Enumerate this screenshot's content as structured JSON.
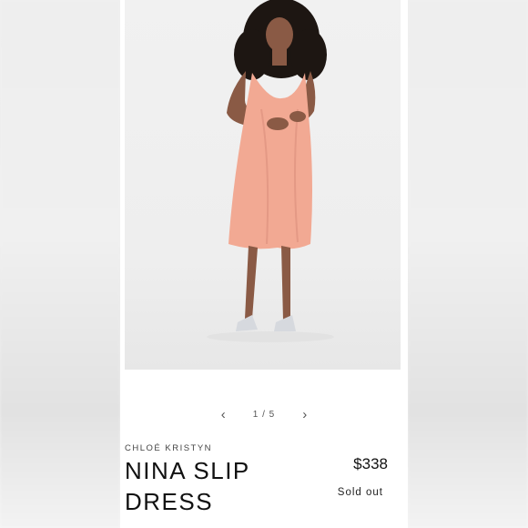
{
  "carousel": {
    "prev_icon": "chevron-left-icon",
    "next_icon": "chevron-right-icon",
    "counter": "1 / 5"
  },
  "product": {
    "brand": "CHLOÉ KRISTYN",
    "title_line1": "NINA SLIP",
    "title_line2": "DRESS",
    "price": "$338",
    "status": "Sold out"
  },
  "colors": {
    "dress": "#f2a993",
    "background": "#efefef",
    "text": "#111111"
  }
}
